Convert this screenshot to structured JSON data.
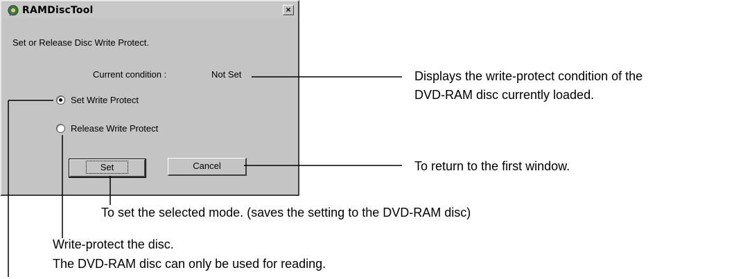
{
  "dialog": {
    "title": "RAMDiscTool",
    "close_glyph": "×",
    "instruction": "Set or Release Disc Write Protect.",
    "condition_label": "Current condition :",
    "condition_value": "Not Set",
    "radio_options": [
      {
        "label": "Set Write Protect",
        "checked": true
      },
      {
        "label": "Release Write Protect",
        "checked": false
      }
    ],
    "set_button": "Set",
    "cancel_button": "Cancel"
  },
  "callouts": {
    "condition_line1": "Displays the write-protect condition of the",
    "condition_line2": "DVD-RAM disc currently loaded.",
    "cancel": "To return to the first window.",
    "set": "To set the selected mode. (saves the setting to the DVD-RAM disc)",
    "write_protect_line1": "Write-protect the disc.",
    "write_protect_line2": "The DVD-RAM disc can only be used for reading."
  },
  "icons": [
    "app-icon",
    "close-icon",
    "radio-icon"
  ]
}
